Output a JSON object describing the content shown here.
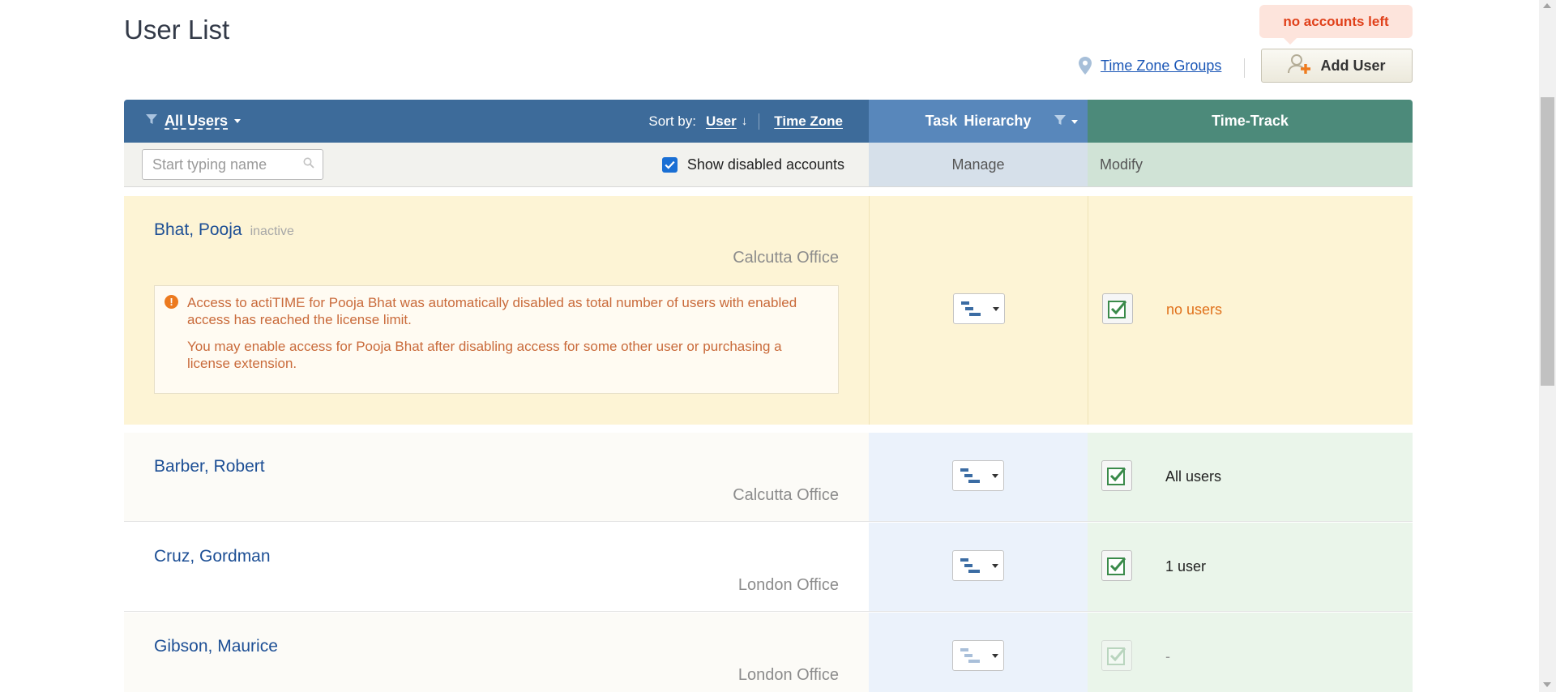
{
  "page": {
    "title": "User List"
  },
  "toolbar": {
    "tz_groups_label": "Time Zone Groups",
    "add_user_label": "Add User",
    "tooltip": "no accounts left"
  },
  "header": {
    "filter_label": "All Users",
    "sort_by_label": "Sort by:",
    "sort_user": "User",
    "sort_timezone": "Time Zone",
    "task_word1": "Task",
    "task_word2": "Hierarchy",
    "timetrack": "Time-Track"
  },
  "subheader": {
    "search_placeholder": "Start typing name",
    "show_disabled_label": "Show disabled accounts",
    "show_disabled_checked": true,
    "manage": "Manage",
    "modify": "Modify"
  },
  "users": [
    {
      "name": "Bhat, Pooja",
      "status": "inactive",
      "office": "Calcutta Office",
      "tt_value": "no users",
      "warning_p1": "Access to actiTIME for Pooja Bhat was automatically disabled as total number of users with enabled access has reached the license limit.",
      "warning_p2": "You may enable access for Pooja Bhat after disabling access for some other user or purchasing a license extension."
    },
    {
      "name": "Barber, Robert",
      "office": "Calcutta Office",
      "tt_value": "All users"
    },
    {
      "name": "Cruz, Gordman",
      "office": "London Office",
      "tt_value": "1 user"
    },
    {
      "name": "Gibson, Maurice",
      "office": "London Office",
      "tt_value": "-"
    }
  ],
  "colors": {
    "header_users": "#3d6b9a",
    "header_task": "#5887bb",
    "header_timetrack": "#4c8a7a",
    "inactive_row_bg": "#fdf4d5",
    "warning_text": "#c96a3a",
    "no_users_text": "#e0701a"
  }
}
